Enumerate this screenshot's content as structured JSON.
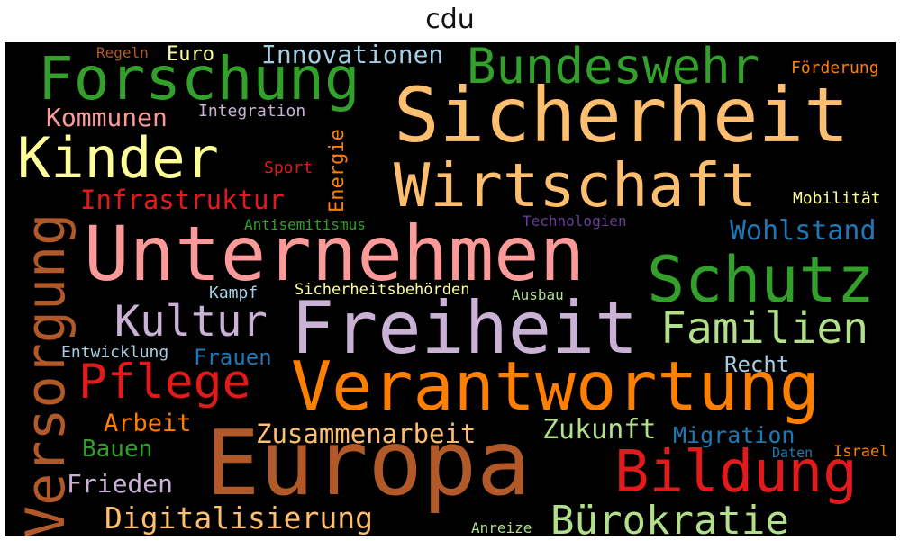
{
  "title": "cdu",
  "words": [
    {
      "text": "Europa",
      "color": "#b15928"
    },
    {
      "text": "Sicherheit",
      "color": "#fdbf6f"
    },
    {
      "text": "Unternehmen",
      "color": "#fb9a99"
    },
    {
      "text": "Freiheit",
      "color": "#cab2d6"
    },
    {
      "text": "Verantwortung",
      "color": "#ff7f00"
    },
    {
      "text": "Wirtschaft",
      "color": "#fdbf6f"
    },
    {
      "text": "Schutz",
      "color": "#33a02c"
    },
    {
      "text": "Bildung",
      "color": "#e31a1c"
    },
    {
      "text": "Forschung",
      "color": "#33a02c"
    },
    {
      "text": "Kinder",
      "color": "#ffff99"
    },
    {
      "text": "Bundeswehr",
      "color": "#33a02c"
    },
    {
      "text": "Versorgung",
      "color": "#b15928"
    },
    {
      "text": "Pflege",
      "color": "#e31a1c"
    },
    {
      "text": "Familien",
      "color": "#b2df8a"
    },
    {
      "text": "Kultur",
      "color": "#cab2d6"
    },
    {
      "text": "Bürokratie",
      "color": "#b2df8a"
    },
    {
      "text": "Digitalisierung",
      "color": "#fdbf6f"
    },
    {
      "text": "Zusammenarbeit",
      "color": "#fdbf6f"
    },
    {
      "text": "Infrastruktur",
      "color": "#e31a1c"
    },
    {
      "text": "Wohlstand",
      "color": "#1f78b4"
    },
    {
      "text": "Zukunft",
      "color": "#b2df8a"
    },
    {
      "text": "Kommunen",
      "color": "#fb9a99"
    },
    {
      "text": "Innovationen",
      "color": "#a6cee3"
    },
    {
      "text": "Frieden",
      "color": "#cab2d6"
    },
    {
      "text": "Migration",
      "color": "#1f78b4"
    },
    {
      "text": "Arbeit",
      "color": "#ff7f00"
    },
    {
      "text": "Bauen",
      "color": "#33a02c"
    },
    {
      "text": "Recht",
      "color": "#a6cee3"
    },
    {
      "text": "Frauen",
      "color": "#1f78b4"
    },
    {
      "text": "Energie",
      "color": "#ff7f00"
    },
    {
      "text": "Euro",
      "color": "#ffff99"
    },
    {
      "text": "Förderung",
      "color": "#ff7f00"
    },
    {
      "text": "Integration",
      "color": "#cab2d6"
    },
    {
      "text": "Mobilität",
      "color": "#ffff99"
    },
    {
      "text": "Sport",
      "color": "#e31a1c"
    },
    {
      "text": "Antisemitismus",
      "color": "#33a02c"
    },
    {
      "text": "Technologien",
      "color": "#6a3d9a"
    },
    {
      "text": "Kampf",
      "color": "#a6cee3"
    },
    {
      "text": "Sicherheitsbehörden",
      "color": "#ffff99"
    },
    {
      "text": "Ausbau",
      "color": "#b2df8a"
    },
    {
      "text": "Entwicklung",
      "color": "#a6cee3"
    },
    {
      "text": "Regeln",
      "color": "#b15928"
    },
    {
      "text": "Daten",
      "color": "#1f78b4"
    },
    {
      "text": "Israel",
      "color": "#ff7f00"
    },
    {
      "text": "Anreize",
      "color": "#b2df8a"
    }
  ]
}
